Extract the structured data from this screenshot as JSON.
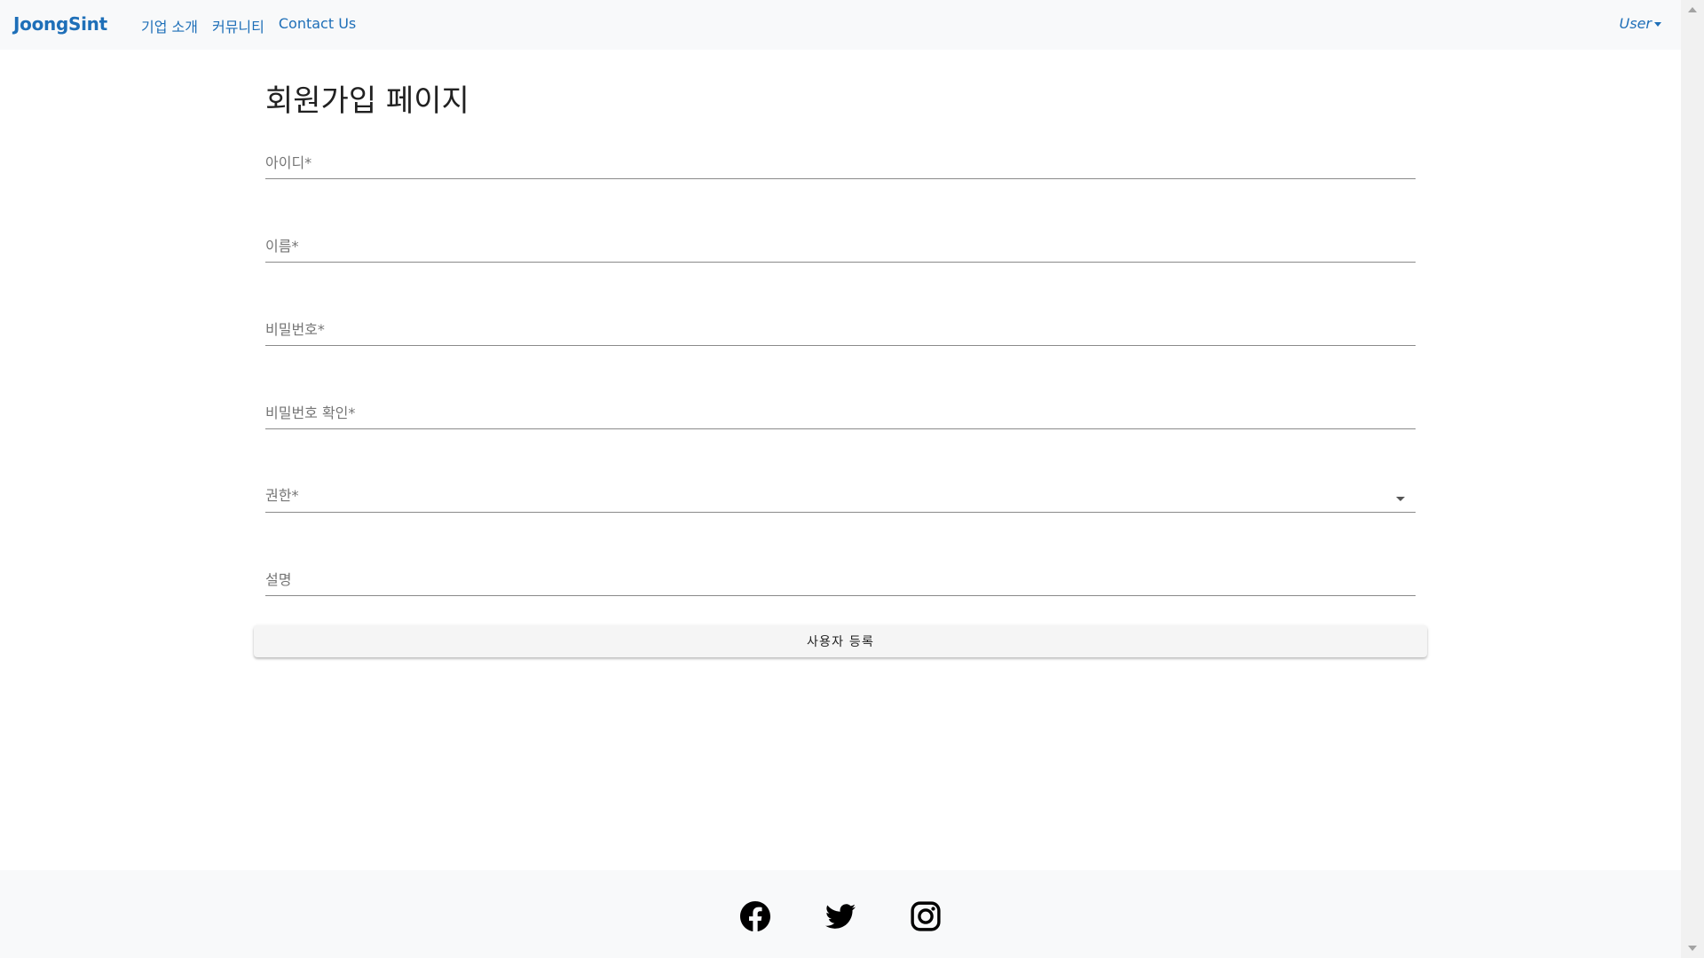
{
  "navbar": {
    "brand": "JoongSint",
    "links": [
      "기업 소개",
      "커뮤니티",
      "Contact Us"
    ],
    "user_menu": "User"
  },
  "form": {
    "title": "회원가입 페이지",
    "fields": {
      "id_label": "아이디*",
      "name_label": "이름*",
      "password_label": "비밀번호*",
      "password_confirm_label": "비밀번호 확인*",
      "role_label": "권한*",
      "description_label": "설명"
    },
    "submit_label": "사용자 등록"
  },
  "footer": {
    "icons": [
      "facebook-icon",
      "twitter-icon",
      "instagram-icon"
    ]
  },
  "colors": {
    "accent": "#1e6fb8",
    "navbar_bg": "#f8f9fa",
    "footer_bg": "#f8f9fa"
  }
}
